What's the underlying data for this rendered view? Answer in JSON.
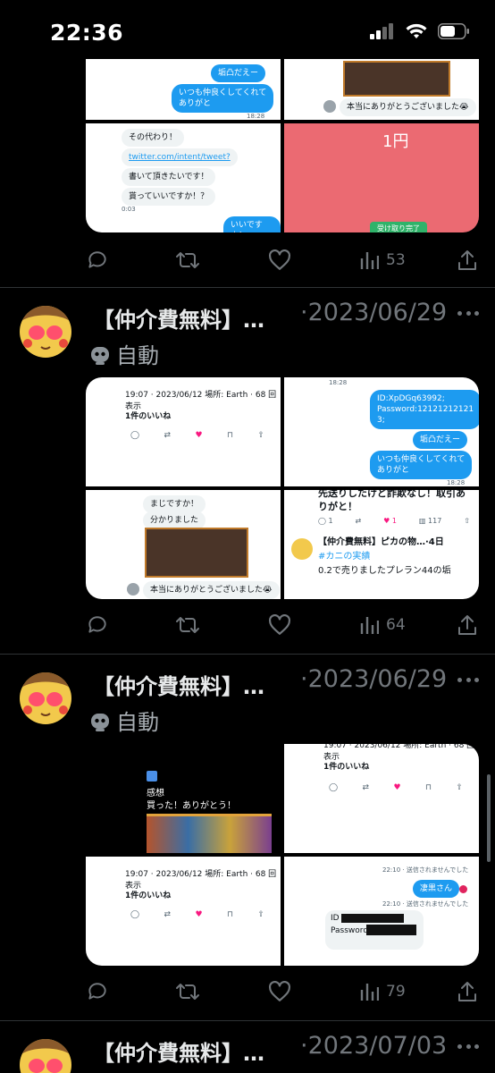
{
  "status_bar": {
    "time": "22:36"
  },
  "tweets": [
    {
      "views": "53",
      "images": {
        "tl": {
          "bubble1": "垢凸だえー",
          "bubble2": "いつも仲良くしてくれて\nありがと",
          "time": "18:28"
        },
        "tr": {
          "text": "本当にありがとうございました😭"
        },
        "bl": {
          "lines": [
            "その代わり！",
            "twitter.com/intent/tweet?",
            "書いて頂きたいです！",
            "貰っていいですか！？"
          ],
          "time": "0:03",
          "reply": "いいですよ！"
        },
        "br": {
          "price": "1円",
          "button": "受け取り完了"
        }
      }
    },
    {
      "name": "【仲介費無料】…",
      "date": "·2023/06/29",
      "bot_label": "自動",
      "views": "64",
      "images": {
        "tl": {
          "meta": "19:07 · 2023/06/12 場所: Earth · 68 回表示",
          "likes": "1件のいいね"
        },
        "tr": {
          "time": "18:28",
          "bubble1": "ID:XpDGq63992;\nPassword:12121212121\n3;",
          "bubble2": "垢凸だえー",
          "bubble3": "いつも仲良くしてくれて\nありがと",
          "time2": "18:28"
        },
        "bl": {
          "line1": "まじですか！",
          "line2": "分かりました",
          "text": "本当にありがとうございました😭"
        },
        "br": {
          "text1": "先送りしたけど詐欺なし！取引ありがと！",
          "reply": "1",
          "like": "1",
          "views": "117",
          "name": "【仲介費無料】ピカの物…·4日",
          "tag": "#カニの実績",
          "text2": "0.2で売りましたプレラン44の垢"
        }
      }
    },
    {
      "name": "【仲介費無料】…",
      "date": "·2023/06/29",
      "bot_label": "自動",
      "views": "79",
      "images": {
        "tl": {
          "label": "感想",
          "text": "買った！ありがとう！"
        },
        "tr": {
          "meta": "19:07 · 2023/06/12 場所: Earth · 68 回表示",
          "likes": "1件のいいね"
        },
        "bl": {
          "meta": "19:07 · 2023/06/12 場所: Earth · 68 回表示",
          "likes": "1件のいいね"
        },
        "br": {
          "status1": "22:10 · 送信されませんでした",
          "bubble": "凄黒さん",
          "status2": "22:10 · 送信されませんでした",
          "id": "ID",
          "password": "Password"
        }
      }
    },
    {
      "name": "【仲介費無料】…",
      "date": "·2023/07/03"
    }
  ]
}
